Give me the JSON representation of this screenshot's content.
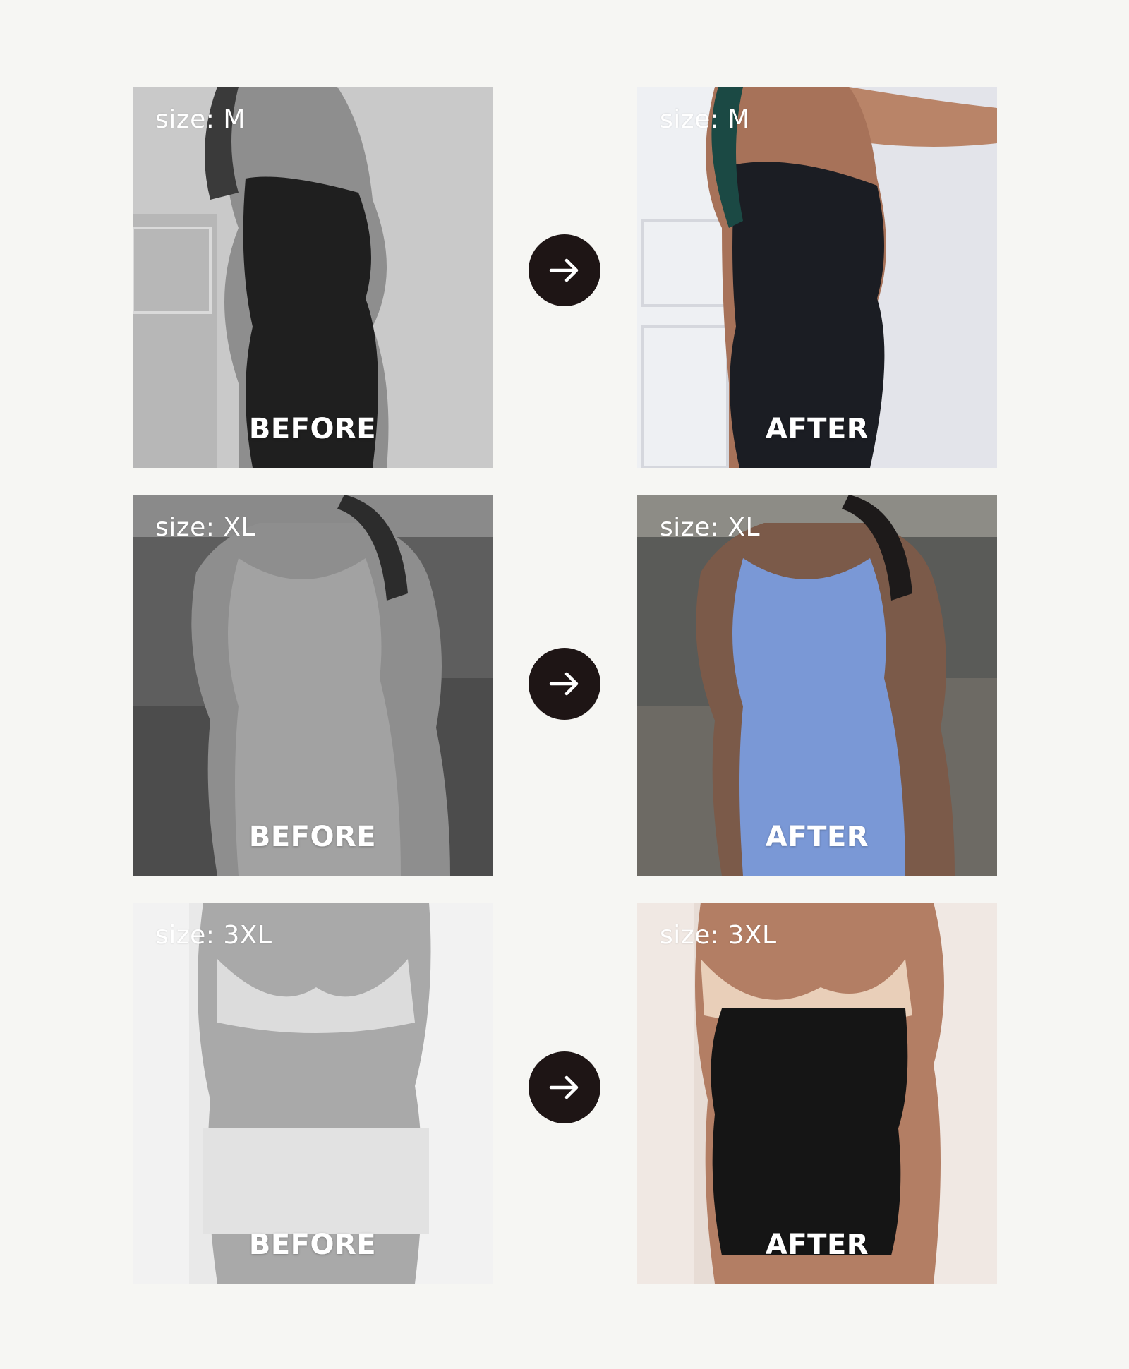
{
  "rows": [
    {
      "before": {
        "size_label": "size: M",
        "state_label": "BEFORE"
      },
      "after": {
        "size_label": "size: M",
        "state_label": "AFTER"
      },
      "arrow_icon": "arrow-right-icon"
    },
    {
      "before": {
        "size_label": "size: XL",
        "state_label": "BEFORE"
      },
      "after": {
        "size_label": "size: XL",
        "state_label": "AFTER"
      },
      "arrow_icon": "arrow-right-icon"
    },
    {
      "before": {
        "size_label": "size: 3XL",
        "state_label": "BEFORE"
      },
      "after": {
        "size_label": "size: 3XL",
        "state_label": "AFTER"
      },
      "arrow_icon": "arrow-right-icon"
    }
  ],
  "colors": {
    "page_background": "#f6f6f3",
    "arrow_button": "#1e1515",
    "label_text": "#ffffff"
  }
}
